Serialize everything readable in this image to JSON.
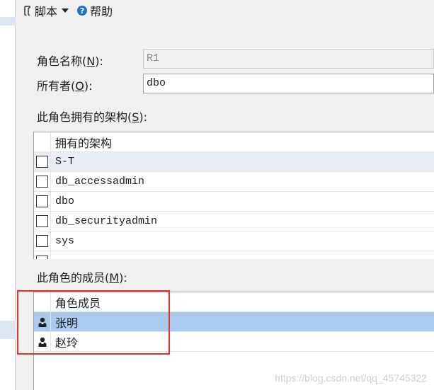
{
  "toolbar": {
    "script_label": "脚本",
    "help_label": "帮助",
    "help_glyph": "?"
  },
  "form": {
    "role_name": {
      "label_before": "角色名称(",
      "accesskey": "N",
      "label_after": "):",
      "value": "R1"
    },
    "owner": {
      "label_before": "所有者(",
      "accesskey": "O",
      "label_after": "):",
      "value": "dbo"
    }
  },
  "schemas": {
    "label_before": "此角色拥有的架构(",
    "accesskey": "S",
    "label_after": "):",
    "column_header": "拥有的架构",
    "rows": [
      "S-T",
      "db_accessadmin",
      "dbo",
      "db_securityadmin",
      "sys"
    ]
  },
  "members": {
    "label_before": "此角色的成员(",
    "accesskey": "M",
    "label_after": "):",
    "column_header": "角色成员",
    "rows": [
      "张明",
      "赵玲"
    ]
  },
  "watermark": "https://blog.csdn.net/qq_45745322"
}
